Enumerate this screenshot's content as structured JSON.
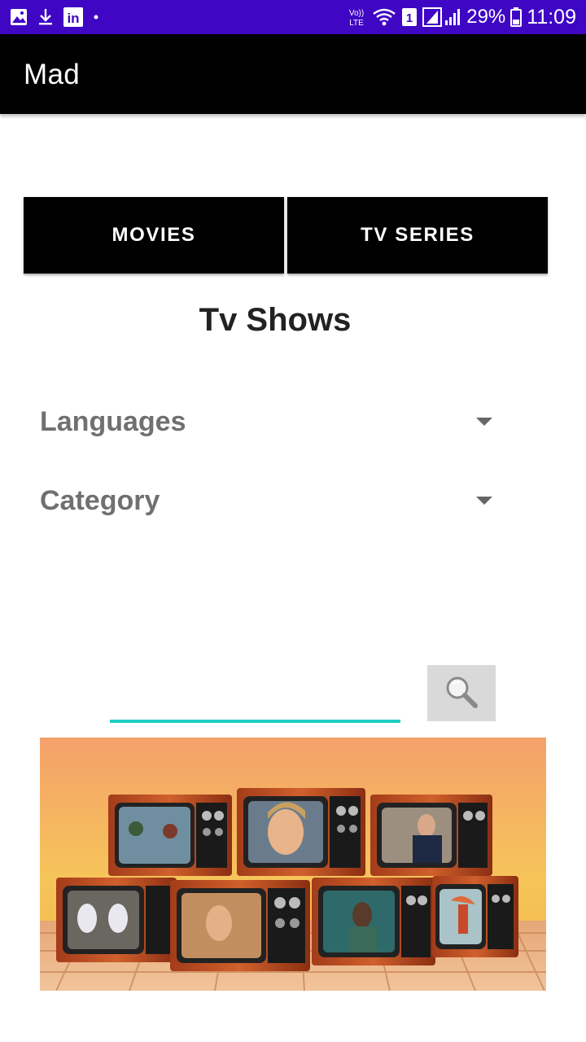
{
  "status_bar": {
    "battery_text": "29%",
    "time": "11:09",
    "sim_badge": "1",
    "icons": [
      "image-icon",
      "download-icon",
      "linkedin-icon",
      "dot-icon",
      "volte-icon",
      "wifi-icon",
      "sim-icon",
      "signal-icon",
      "battery-icon"
    ],
    "network_label": "Vo)) LTE",
    "linkedin_label": "in"
  },
  "app_bar": {
    "title": "Mad"
  },
  "tabs": {
    "movies_label": "MOVIES",
    "tv_series_label": "TV SERIES"
  },
  "heading": "Tv Shows",
  "filters": {
    "languages_label": "Languages",
    "category_label": "Category"
  },
  "search": {
    "placeholder": "",
    "value": ""
  },
  "banner": {
    "description": ""
  },
  "colors": {
    "status_bar": "#3f06c4",
    "app_bar": "#000000",
    "accent": "#1ccfc4",
    "button_bg": "#000000",
    "search_button_bg": "#d9d9d9"
  }
}
